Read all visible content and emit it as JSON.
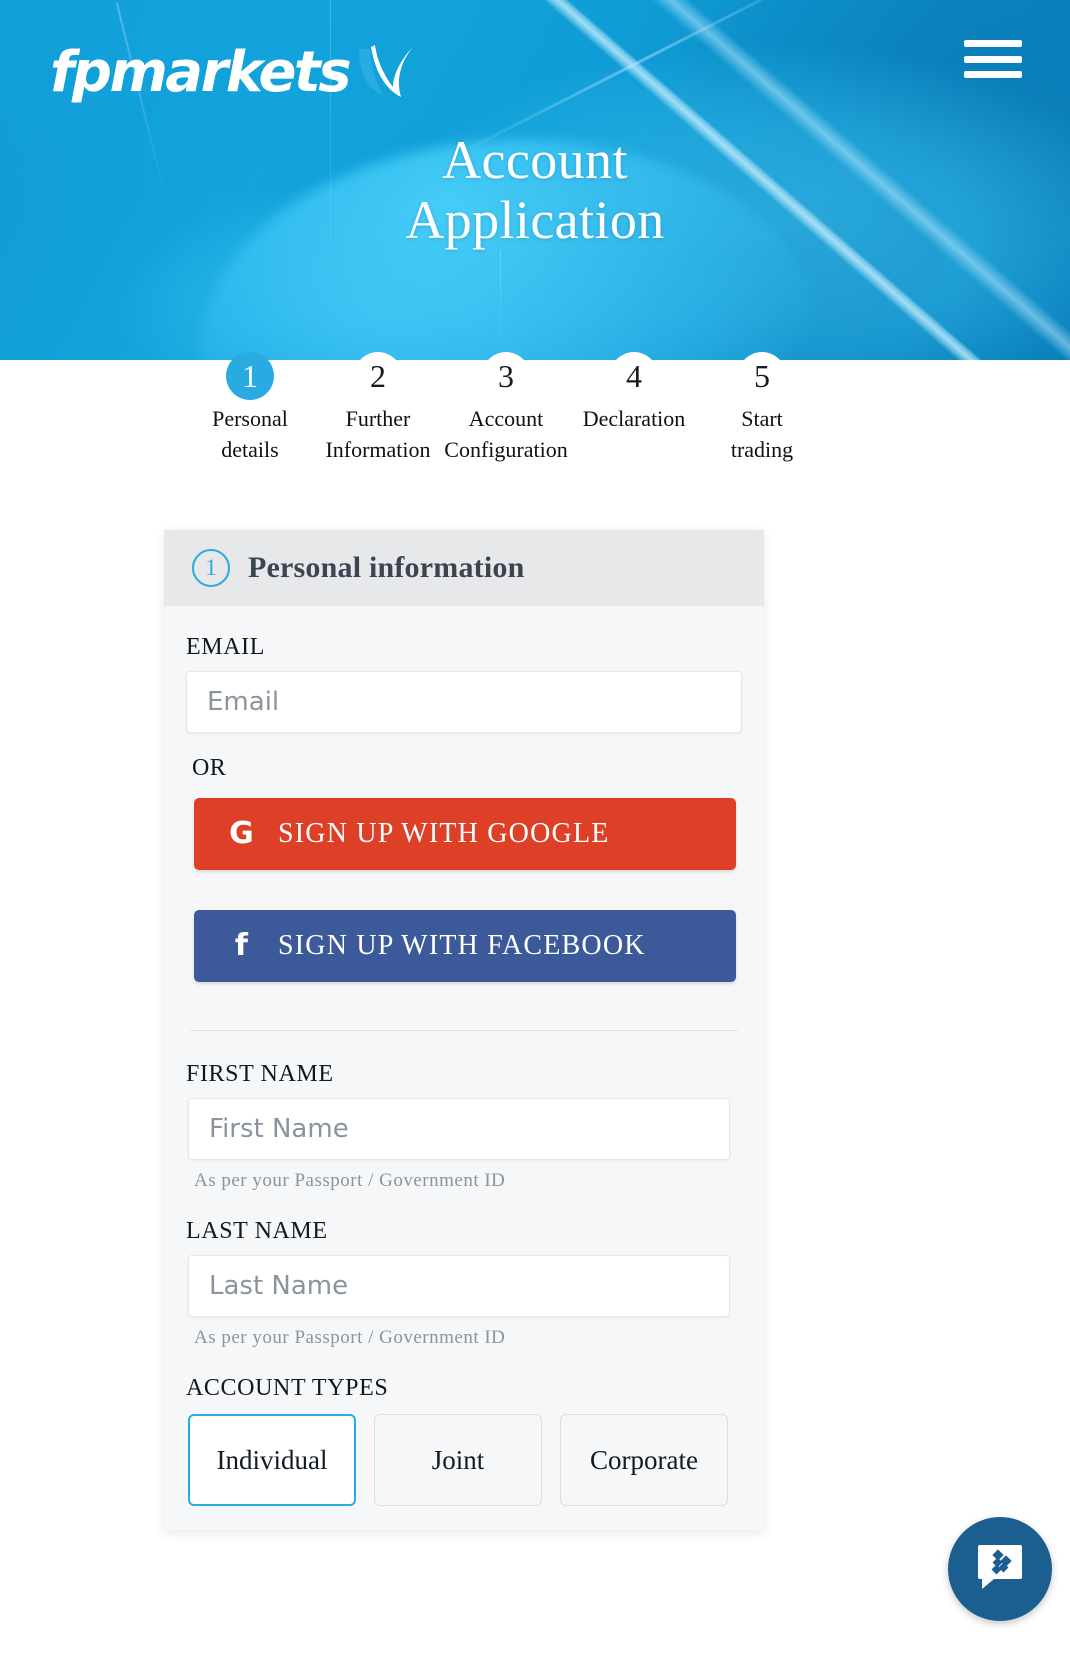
{
  "brand": {
    "name": "fpmarkets",
    "logo_mark": "swoosh-checkmark",
    "accent_blue": "#29abe2",
    "header_blue": "#0f9ad4"
  },
  "header": {
    "menu_icon": "hamburger-menu-icon",
    "title_line1": "Account",
    "title_line2": "Application"
  },
  "stepper": {
    "steps": [
      {
        "number": "1",
        "label": "Personal\ndetails",
        "active": true
      },
      {
        "number": "2",
        "label": "Further\nInformation",
        "active": false
      },
      {
        "number": "3",
        "label": "Account\nConfiguration",
        "active": false
      },
      {
        "number": "4",
        "label": "Declaration",
        "active": false
      },
      {
        "number": "5",
        "label": "Start\ntrading",
        "active": false
      }
    ]
  },
  "card": {
    "step_number": "1",
    "title": "Personal information",
    "email": {
      "label": "EMAIL",
      "placeholder": "Email",
      "value": ""
    },
    "or_label": "OR",
    "social": {
      "google": {
        "label": "SIGN UP WITH GOOGLE",
        "icon": "google-g-icon",
        "color": "#dd4026"
      },
      "facebook": {
        "label": "SIGN UP WITH FACEBOOK",
        "icon": "facebook-f-icon",
        "color": "#3c5a9a"
      }
    },
    "first_name": {
      "label": "FIRST NAME",
      "placeholder": "First Name",
      "value": "",
      "helper": "As per your Passport / Government ID"
    },
    "last_name": {
      "label": "LAST NAME",
      "placeholder": "Last Name",
      "value": "",
      "helper": "As per your Passport / Government ID"
    },
    "account_types": {
      "label": "ACCOUNT TYPES",
      "options": [
        {
          "label": "Individual",
          "selected": true
        },
        {
          "label": "Joint",
          "selected": false
        },
        {
          "label": "Corporate",
          "selected": false
        }
      ]
    }
  },
  "chat": {
    "icon": "chat-bubble-icon",
    "color": "#1a5f8f"
  }
}
